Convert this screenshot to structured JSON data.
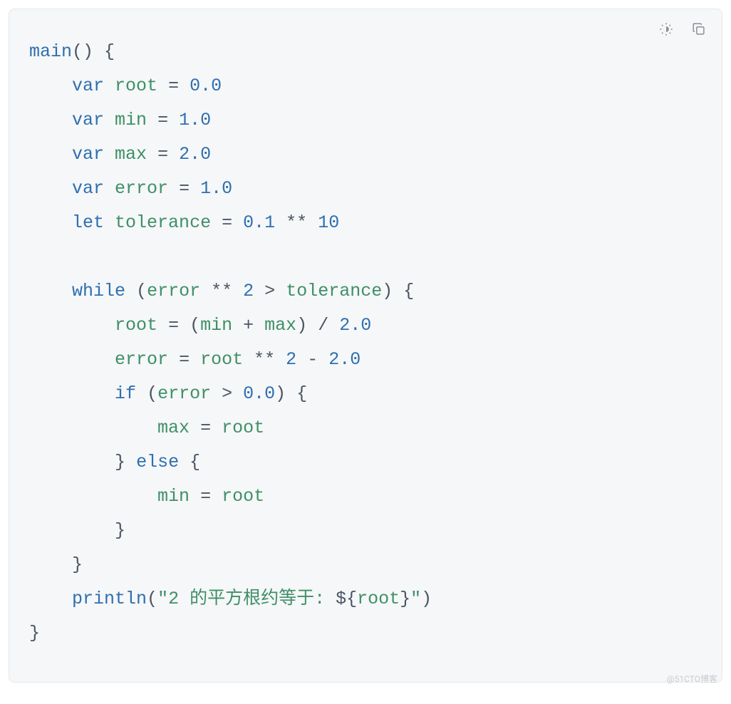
{
  "toolbar": {
    "theme_icon": "theme-toggle-icon",
    "copy_icon": "copy-icon"
  },
  "watermark": "@51CTO博客",
  "code": {
    "line1": {
      "fn": "main",
      "parens": "()",
      "space": " ",
      "brace_open": "{"
    },
    "line2": {
      "indent": "    ",
      "kw": "var",
      "sp1": " ",
      "id": "root",
      "sp2": " ",
      "eq": "=",
      "sp3": " ",
      "num": "0.0"
    },
    "line3": {
      "indent": "    ",
      "kw": "var",
      "sp1": " ",
      "id": "min",
      "sp2": " ",
      "eq": "=",
      "sp3": " ",
      "num": "1.0"
    },
    "line4": {
      "indent": "    ",
      "kw": "var",
      "sp1": " ",
      "id": "max",
      "sp2": " ",
      "eq": "=",
      "sp3": " ",
      "num": "2.0"
    },
    "line5": {
      "indent": "    ",
      "kw": "var",
      "sp1": " ",
      "id": "error",
      "sp2": " ",
      "eq": "=",
      "sp3": " ",
      "num": "1.0"
    },
    "line6": {
      "indent": "    ",
      "kw": "let",
      "sp1": " ",
      "id": "tolerance",
      "sp2": " ",
      "eq": "=",
      "sp3": " ",
      "num1": "0.1",
      "sp4": " ",
      "op": "**",
      "sp5": " ",
      "num2": "10"
    },
    "blank": "",
    "line7": {
      "indent": "    ",
      "kw": "while",
      "sp1": " ",
      "lp": "(",
      "id1": "error",
      "sp2": " ",
      "op1": "**",
      "sp3": " ",
      "num": "2",
      "sp4": " ",
      "gt": ">",
      "sp5": " ",
      "id2": "tolerance",
      "rp": ")",
      "sp6": " ",
      "brace": "{"
    },
    "line8": {
      "indent": "        ",
      "id1": "root",
      "sp1": " ",
      "eq": "=",
      "sp2": " ",
      "lp": "(",
      "id2": "min",
      "sp3": " ",
      "plus": "+",
      "sp4": " ",
      "id3": "max",
      "rp": ")",
      "sp5": " ",
      "div": "/",
      "sp6": " ",
      "num": "2.0"
    },
    "line9": {
      "indent": "        ",
      "id1": "error",
      "sp1": " ",
      "eq": "=",
      "sp2": " ",
      "id2": "root",
      "sp3": " ",
      "op": "**",
      "sp4": " ",
      "num1": "2",
      "sp5": " ",
      "minus": "-",
      "sp6": " ",
      "num2": "2.0"
    },
    "line10": {
      "indent": "        ",
      "kw": "if",
      "sp1": " ",
      "lp": "(",
      "id": "error",
      "sp2": " ",
      "gt": ">",
      "sp3": " ",
      "num": "0.0",
      "rp": ")",
      "sp4": " ",
      "brace": "{"
    },
    "line11": {
      "indent": "            ",
      "id1": "max",
      "sp1": " ",
      "eq": "=",
      "sp2": " ",
      "id2": "root"
    },
    "line12": {
      "indent": "        ",
      "rbrace": "}",
      "sp1": " ",
      "kw": "else",
      "sp2": " ",
      "lbrace": "{"
    },
    "line13": {
      "indent": "            ",
      "id1": "min",
      "sp1": " ",
      "eq": "=",
      "sp2": " ",
      "id2": "root"
    },
    "line14": {
      "indent": "        ",
      "rbrace": "}"
    },
    "line15": {
      "indent": "    ",
      "rbrace": "}"
    },
    "line16": {
      "indent": "    ",
      "fn": "println",
      "lp": "(",
      "q1": "\"",
      "str": "2 的平方根约等于: ",
      "dollar": "$",
      "lb": "{",
      "id": "root",
      "rb": "}",
      "q2": "\"",
      "rp": ")"
    },
    "line17": {
      "rbrace": "}"
    }
  }
}
